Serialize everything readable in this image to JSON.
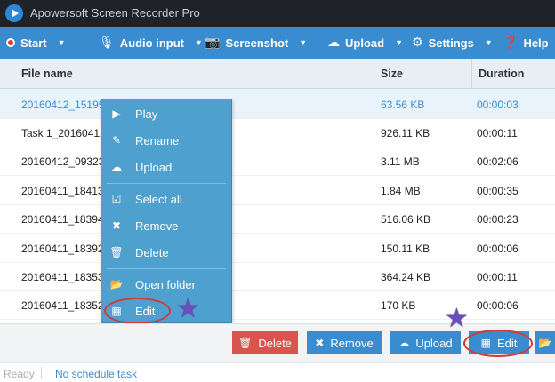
{
  "window": {
    "title": "Apowersoft Screen Recorder Pro"
  },
  "toolbar": {
    "start": {
      "label": "Start",
      "icon": "record-icon"
    },
    "audio": {
      "label": "Audio input",
      "icon": "microphone-icon"
    },
    "screenshot": {
      "label": "Screenshot",
      "icon": "camera-icon"
    },
    "upload": {
      "label": "Upload",
      "icon": "cloud-upload-icon"
    },
    "settings": {
      "label": "Settings",
      "icon": "gear-icon"
    },
    "help": {
      "label": "Help",
      "icon": "help-icon"
    }
  },
  "table": {
    "columns": {
      "name": "File name",
      "size": "Size",
      "duration": "Duration"
    },
    "rows": [
      {
        "name": "20160412_151953",
        "size": "63.56 KB",
        "duration": "00:00:03",
        "selected": true
      },
      {
        "name": "Task 1_20160412_",
        "size": "926.11 KB",
        "duration": "00:00:11"
      },
      {
        "name": "20160412_093232",
        "size": "3.11 MB",
        "duration": "00:02:06"
      },
      {
        "name": "20160411_184130",
        "size": "1.84 MB",
        "duration": "00:00:35"
      },
      {
        "name": "20160411_183946",
        "size": "516.06 KB",
        "duration": "00:00:23"
      },
      {
        "name": "20160411_183923",
        "size": "150.11 KB",
        "duration": "00:00:06"
      },
      {
        "name": "20160411_183538",
        "size": "364.24 KB",
        "duration": "00:00:11"
      },
      {
        "name": "20160411_183525",
        "size": "170 KB",
        "duration": "00:00:06"
      }
    ]
  },
  "context_menu": {
    "items": [
      {
        "label": "Play",
        "icon": "play-icon"
      },
      {
        "label": "Rename",
        "icon": "rename-icon"
      },
      {
        "label": "Upload",
        "icon": "cloud-upload-icon"
      },
      {
        "label": "Select all",
        "icon": "checkbox-icon"
      },
      {
        "label": "Remove",
        "icon": "remove-icon"
      },
      {
        "label": "Delete",
        "icon": "trash-icon"
      },
      {
        "label": "Open folder",
        "icon": "folder-icon"
      },
      {
        "label": "Edit",
        "icon": "edit-icon"
      }
    ]
  },
  "bottom_buttons": {
    "delete": {
      "label": "Delete",
      "color": "#d9534f",
      "icon": "trash-icon"
    },
    "remove": {
      "label": "Remove",
      "color": "#3a8cd0",
      "icon": "remove-icon"
    },
    "upload": {
      "label": "Upload",
      "color": "#3a8cd0",
      "icon": "cloud-upload-icon"
    },
    "edit": {
      "label": "Edit",
      "color": "#3a8cd0",
      "icon": "edit-icon"
    }
  },
  "status": {
    "ready": "Ready",
    "schedule": "No schedule task"
  },
  "colors": {
    "toolbar": "#3a8cd0",
    "titlebar": "#1f2226",
    "menu": "#4ea0cf",
    "annotation": "#d23a3a",
    "star": "#6a4fb8"
  }
}
